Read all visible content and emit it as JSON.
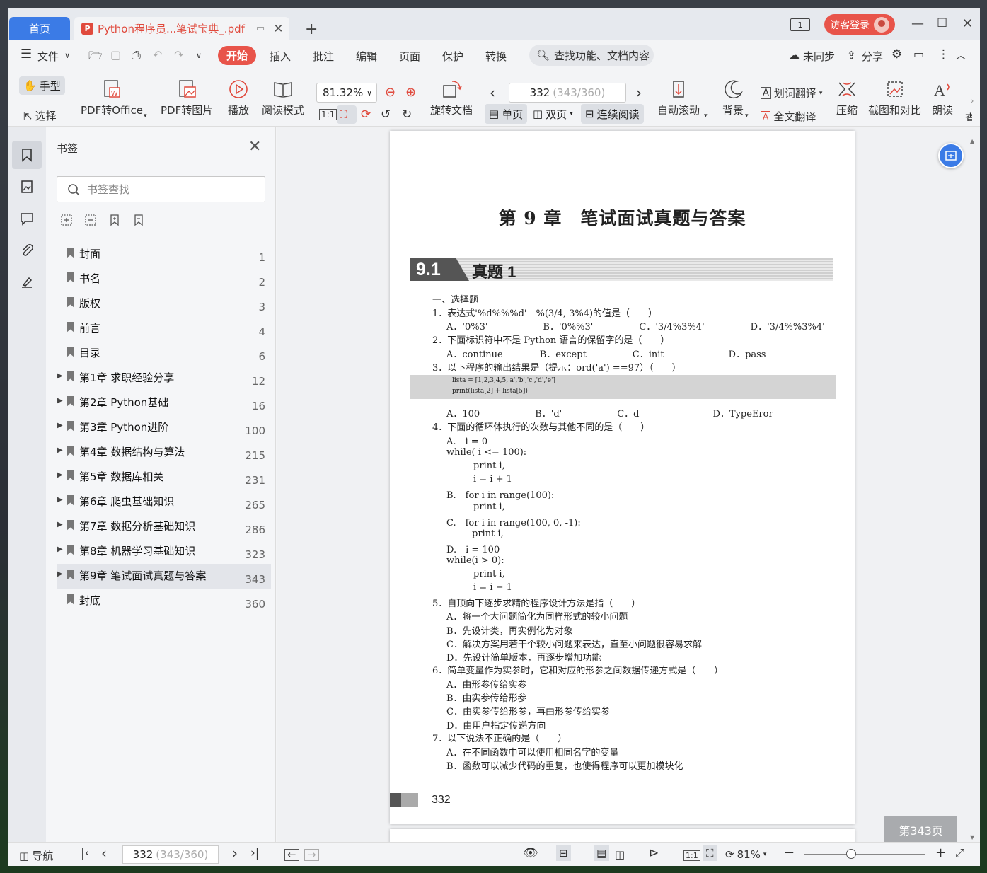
{
  "window": {
    "home_tab": "首页",
    "doc_tab": "Python程序员...笔试宝典_.pdf",
    "pdf_icon": "P",
    "badge": "1",
    "login": "访客登录"
  },
  "menu": {
    "file": "文件",
    "items": [
      "开始",
      "插入",
      "批注",
      "编辑",
      "页面",
      "保护",
      "转换"
    ],
    "search": "查找功能、文档内容",
    "sync": "未同步",
    "share": "分享"
  },
  "toolbar": {
    "hand": "手型",
    "select": "选择",
    "pdf_office": "PDF转Office",
    "pdf_image": "PDF转图片",
    "play": "播放",
    "read_mode": "阅读模式",
    "zoom": "81.32%",
    "rotate": "旋转文档",
    "page_current": "332",
    "page_total": "(343/360)",
    "single": "单页",
    "double": "双页",
    "continuous": "连续阅读",
    "autoscroll": "自动滚动",
    "background": "背景",
    "word_translate": "划词翻译",
    "full_translate": "全文翻译",
    "compress": "压缩",
    "screenshot": "截图和对比",
    "read_aloud": "朗读",
    "more": "查"
  },
  "sidepanel": {
    "title": "书签",
    "search_placeholder": "书签查找",
    "bookmarks": [
      {
        "label": "封面",
        "page": "1",
        "arrow": false
      },
      {
        "label": "书名",
        "page": "2",
        "arrow": false
      },
      {
        "label": "版权",
        "page": "3",
        "arrow": false
      },
      {
        "label": "前言",
        "page": "4",
        "arrow": false
      },
      {
        "label": "目录",
        "page": "6",
        "arrow": false
      },
      {
        "label": "第1章 求职经验分享",
        "page": "12",
        "arrow": true
      },
      {
        "label": "第2章 Python基础",
        "page": "16",
        "arrow": true
      },
      {
        "label": "第3章 Python进阶",
        "page": "100",
        "arrow": true
      },
      {
        "label": "第4章 数据结构与算法",
        "page": "215",
        "arrow": true
      },
      {
        "label": "第5章 数据库相关",
        "page": "231",
        "arrow": true
      },
      {
        "label": "第6章 爬虫基础知识",
        "page": "265",
        "arrow": true
      },
      {
        "label": "第7章 数据分析基础知识",
        "page": "286",
        "arrow": true
      },
      {
        "label": "第8章 机器学习基础知识",
        "page": "323",
        "arrow": true
      },
      {
        "label": "第9章 笔试面试真题与答案",
        "page": "343",
        "arrow": true
      },
      {
        "label": "封底",
        "page": "360",
        "arrow": false
      }
    ]
  },
  "document": {
    "chapter_title": "第 9 章　笔试面试真题与答案",
    "section_num": "9.1",
    "section_name": "真题 1",
    "code1": "lista = [1,2,3,4,5,'a','b','c','d','e']",
    "code2": "print(lista[2] + lista[5])",
    "lines": [
      "一、选择题",
      "1．表达式'%d%%%d'　%(3/4, 3%4)的值是（　　）",
      "A．'0%3'　　　　　　B．'0%%3'　　　　　C．'3/4%3%4'　　　　　D．'3/4%%3%4'",
      "2．下面标识符中不是 Python 语言的保留字的是（　　）",
      "A．continue　　　　B．except　　　　　C．init　　　　　　　D．pass",
      "3．以下程序的输出结果是（提示：ord('a') ==97）（　　）",
      "A．100　　　　　　B．'d'　　　　　　C．d　　　　　　　　D．TypeEror",
      "4．下面的循环体执行的次数与其他不同的是（　　）",
      "A.　i = 0",
      "while( i <= 100):",
      "print i,",
      "i = i + 1",
      "B.　for i in range(100):",
      "print i,",
      "C.　for i in range(100, 0, -1):",
      "print i,",
      "D.　i = 100",
      "while(i > 0):",
      "print i,",
      "i = i − 1",
      "5．自顶向下逐步求精的程序设计方法是指（　　）",
      "A．将一个大问题简化为同样形式的较小问题",
      "B．先设计类，再实例化为对象",
      "C．解决方案用若干个较小问题来表达，直至小问题很容易求解",
      "D．先设计简单版本，再逐步增加功能",
      "6．简单变量作为实参时，它和对应的形参之间数据传递方式是（　　）",
      "A．由形参传给实参",
      "B．由实参传给形参",
      "C．由实参传给形参，再由形参传给实参",
      "D．由用户指定传递方向",
      "7．以下说法不正确的是（　　）",
      "A．在不同函数中可以使用相同名字的变量",
      "B．函数可以减少代码的重复，也使得程序可以更加模块化"
    ],
    "page_number": "332",
    "page_badge": "第343页"
  },
  "status": {
    "nav": "导航",
    "page_current": "332",
    "page_total": "(343/360)",
    "zoom": "81%"
  }
}
